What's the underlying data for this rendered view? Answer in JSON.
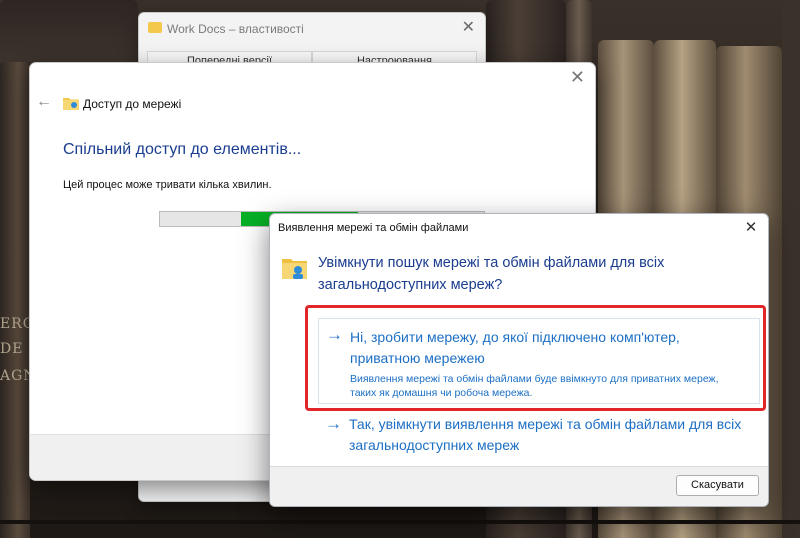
{
  "background": {
    "spine_lines": [
      "ERO",
      "DE A",
      "AGN"
    ]
  },
  "properties_window": {
    "title": "Work Docs – властивості",
    "tabs": [
      "Попередні версії",
      "Настроювання"
    ],
    "close_glyph": "✕"
  },
  "network_dialog": {
    "back_glyph": "←",
    "close_glyph": "✕",
    "title": "Доступ до мережі",
    "heading": "Спільний доступ до елементів...",
    "subtitle": "Цей процес може тривати кілька хвилин.",
    "progress": {
      "segment_start": 0.25,
      "segment_end": 0.61,
      "color": "#06b025"
    }
  },
  "discovery_dialog": {
    "title": "Виявлення мережі та обмін файлами",
    "close_glyph": "✕",
    "question": "Увімкнути пошук мережі та обмін файлами для всіх загальнодоступних мереж?",
    "option_private": {
      "arrow": "→",
      "title_line1": "Ні, зробити мережу, до якої підключено комп'ютер,",
      "title_line2": "приватною мережею",
      "desc_line1": "Виявлення мережі та обмін файлами буде ввімкнуто для приватних мереж,",
      "desc_line2": "таких як домашня чи робоча мережа."
    },
    "option_public": {
      "arrow": "→",
      "title_line1": "Так, увімкнути виявлення мережі та обмін файлами для всіх",
      "title_line2": "загальнодоступних мереж"
    },
    "cancel_label": "Скасувати",
    "highlight_color": "#e0262b"
  }
}
